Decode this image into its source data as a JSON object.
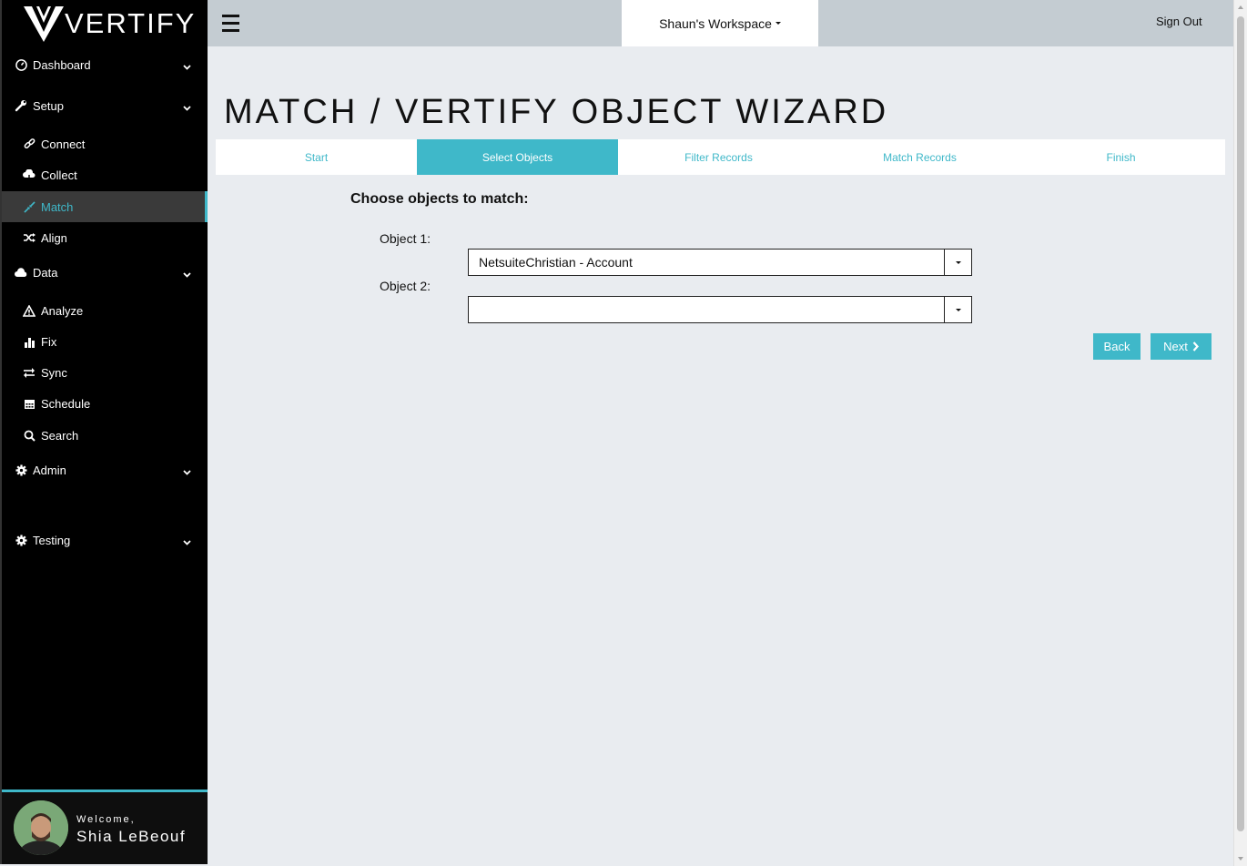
{
  "brand": {
    "name": "VERTIFY",
    "accent": "#3fb8c9"
  },
  "sidebar": {
    "sections": [
      {
        "label": "Dashboard",
        "icon": "dashboard-icon"
      },
      {
        "label": "Setup",
        "icon": "wrench-icon"
      },
      {
        "label": "Data",
        "icon": "cloud-icon"
      },
      {
        "label": "Admin",
        "icon": "gear-icon"
      },
      {
        "label": "Testing",
        "icon": "gear-icon"
      }
    ],
    "setup_items": [
      {
        "label": "Connect",
        "icon": "link-icon"
      },
      {
        "label": "Collect",
        "icon": "cloud-download-icon"
      },
      {
        "label": "Match",
        "icon": "compress-icon",
        "active": true
      },
      {
        "label": "Align",
        "icon": "shuffle-icon"
      }
    ],
    "data_items": [
      {
        "label": "Analyze",
        "icon": "warning-icon"
      },
      {
        "label": "Fix",
        "icon": "bar-chart-icon"
      },
      {
        "label": "Sync",
        "icon": "exchange-icon"
      },
      {
        "label": "Schedule",
        "icon": "calendar-icon"
      },
      {
        "label": "Search",
        "icon": "search-icon"
      }
    ],
    "user": {
      "welcome": "Welcome,",
      "name": "Shia LeBeouf"
    }
  },
  "topbar": {
    "workspace": "Shaun's Workspace",
    "signout": "Sign Out"
  },
  "main": {
    "title": "MATCH / VERTIFY OBJECT WIZARD",
    "tabs": [
      {
        "label": "Start"
      },
      {
        "label": "Select Objects",
        "current": true
      },
      {
        "label": "Filter Records"
      },
      {
        "label": "Match Records"
      },
      {
        "label": "Finish"
      }
    ],
    "heading": "Choose objects to match:",
    "object1": {
      "label": "Object 1:",
      "value": "NetsuiteChristian - Account"
    },
    "object2": {
      "label": "Object 2:",
      "value": ""
    },
    "back_label": "Back",
    "next_label": "Next"
  }
}
